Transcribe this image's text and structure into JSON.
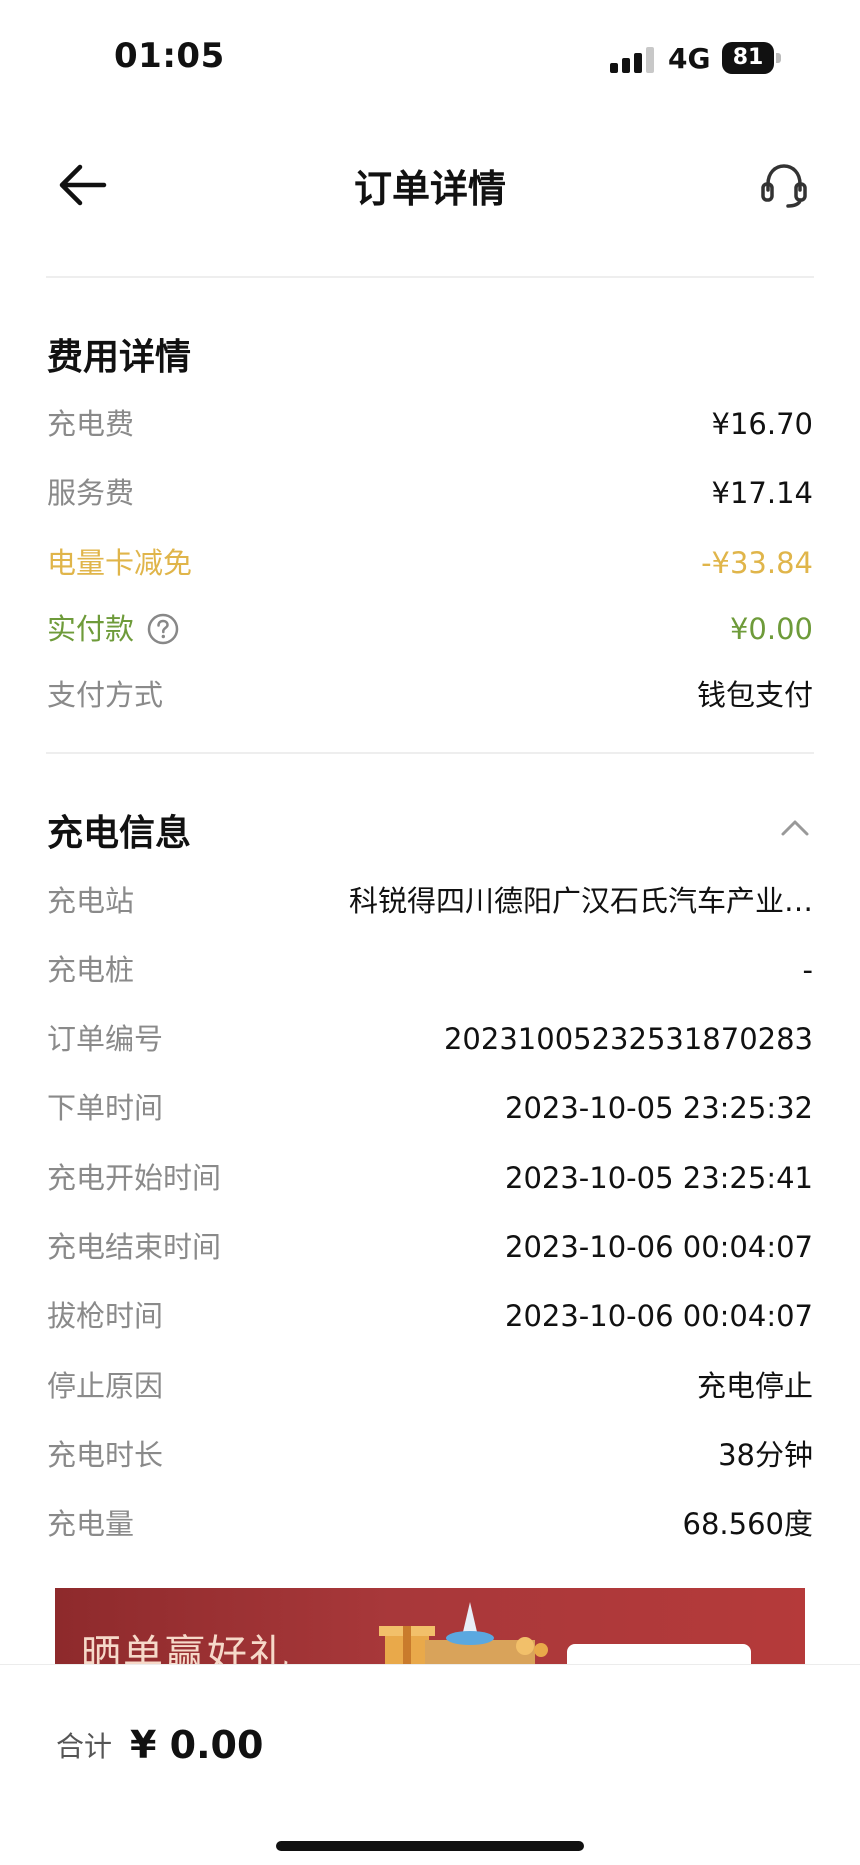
{
  "status_bar": {
    "time": "01:05",
    "network": "4G",
    "battery": "81"
  },
  "nav": {
    "title": "订单详情",
    "back_icon": "arrow-left-icon",
    "support_icon": "headset-icon"
  },
  "fee_section": {
    "title": "费用详情",
    "rows": [
      {
        "label": "充电费",
        "value": "¥16.70"
      },
      {
        "label": "服务费",
        "value": "¥17.14"
      },
      {
        "label": "电量卡减免",
        "value": "-¥33.84"
      },
      {
        "label": "实付款",
        "value": "¥0.00"
      },
      {
        "label": "支付方式",
        "value": "钱包支付"
      }
    ]
  },
  "charge_section": {
    "title": "充电信息",
    "rows": [
      {
        "label": "充电站",
        "value": "科锐得四川德阳广汉石氏汽车产业…"
      },
      {
        "label": "充电桩",
        "value": "-"
      },
      {
        "label": "订单编号",
        "value": "20231005232531870283"
      },
      {
        "label": "下单时间",
        "value": "2023-10-05 23:25:32"
      },
      {
        "label": "充电开始时间",
        "value": "2023-10-05 23:25:41"
      },
      {
        "label": "充电结束时间",
        "value": "2023-10-06 00:04:07"
      },
      {
        "label": "拔枪时间",
        "value": "2023-10-06 00:04:07"
      },
      {
        "label": "停止原因",
        "value": "充电停止"
      },
      {
        "label": "充电时长",
        "value": "38分钟"
      },
      {
        "label": "充电量",
        "value": "68.560度"
      }
    ]
  },
  "banner": {
    "title": "晒单赢好礼"
  },
  "bottom_bar": {
    "total_label": "合计",
    "total_value": "¥ 0.00"
  },
  "colors": {
    "discount": "#e0b54a",
    "paid": "#6e9b3a",
    "label": "#8a8a8a",
    "banner_bg": "#a8383a"
  }
}
